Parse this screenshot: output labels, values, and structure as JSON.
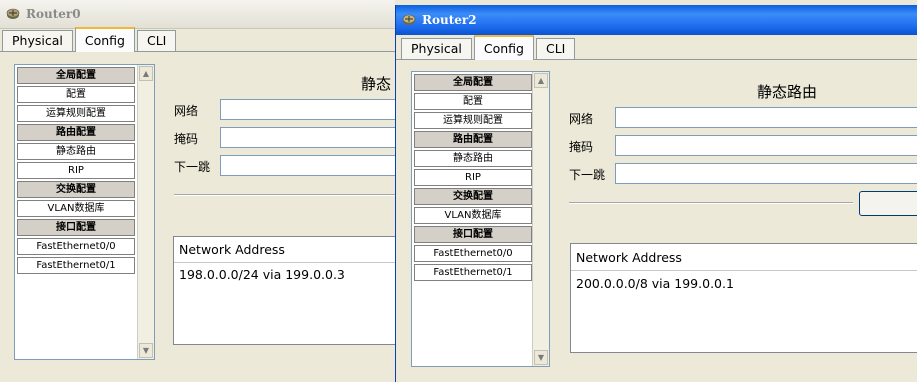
{
  "windows": [
    {
      "title": "Router0",
      "tabs": [
        "Physical",
        "Config",
        "CLI"
      ],
      "active_tab": "Config",
      "nav": [
        {
          "label": "全局配置",
          "header": true
        },
        {
          "label": "配置",
          "header": false
        },
        {
          "label": "运算规则配置",
          "header": false
        },
        {
          "label": "路由配置",
          "header": true
        },
        {
          "label": "静态路由",
          "header": false
        },
        {
          "label": "RIP",
          "header": false
        },
        {
          "label": "交换配置",
          "header": true
        },
        {
          "label": "VLAN数据库",
          "header": false
        },
        {
          "label": "接口配置",
          "header": true
        },
        {
          "label": "FastEthernet0/0",
          "header": false
        },
        {
          "label": "FastEthernet0/1",
          "header": false
        }
      ],
      "section_title": "静态",
      "fields": {
        "network": "网络",
        "mask": "掩码",
        "next_hop": "下一跳"
      },
      "table": {
        "header": "Network Address",
        "rows": [
          "198.0.0.0/24 via 199.0.0.3"
        ]
      }
    },
    {
      "title": "Router2",
      "tabs": [
        "Physical",
        "Config",
        "CLI"
      ],
      "active_tab": "Config",
      "nav": [
        {
          "label": "全局配置",
          "header": true
        },
        {
          "label": "配置",
          "header": false
        },
        {
          "label": "运算规则配置",
          "header": false
        },
        {
          "label": "路由配置",
          "header": true
        },
        {
          "label": "静态路由",
          "header": false
        },
        {
          "label": "RIP",
          "header": false
        },
        {
          "label": "交换配置",
          "header": true
        },
        {
          "label": "VLAN数据库",
          "header": false
        },
        {
          "label": "接口配置",
          "header": true
        },
        {
          "label": "FastEthernet0/0",
          "header": false
        },
        {
          "label": "FastEthernet0/1",
          "header": false
        }
      ],
      "section_title": "静态路由",
      "fields": {
        "network": "网络",
        "mask": "掩码",
        "next_hop": "下一跳"
      },
      "table": {
        "header": "Network Address",
        "rows": [
          "200.0.0.0/8 via 199.0.0.1"
        ]
      }
    }
  ],
  "icons": {
    "title_icon": "router-icon",
    "scroll_up": "scroll-up-arrow-icon",
    "scroll_down": "scroll-down-arrow-icon"
  }
}
